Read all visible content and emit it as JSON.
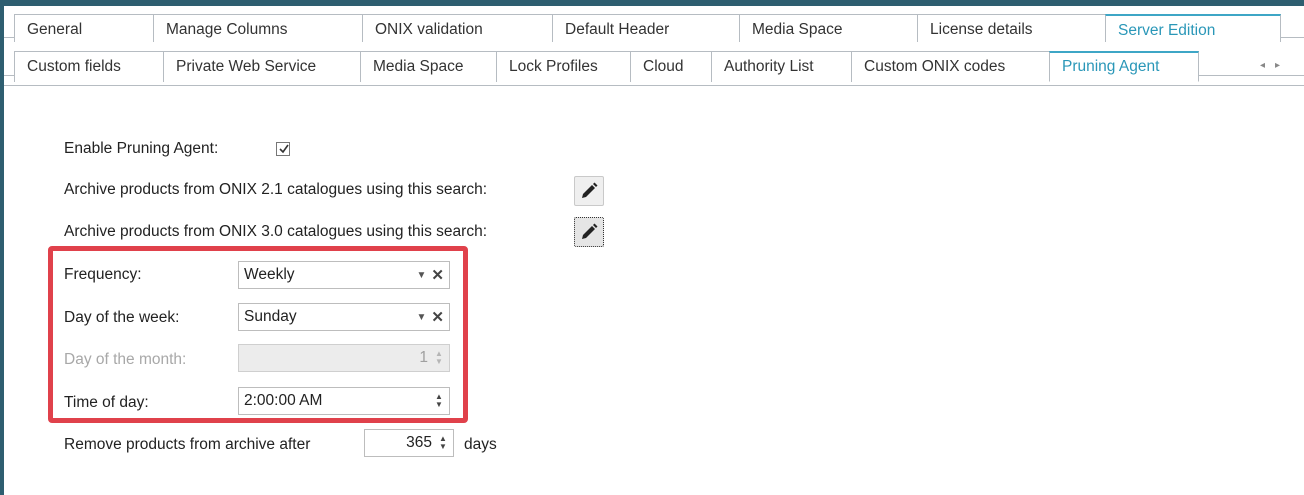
{
  "tabs_row1": [
    {
      "label": "General",
      "active": false
    },
    {
      "label": "Manage Columns",
      "active": false
    },
    {
      "label": "ONIX validation",
      "active": false
    },
    {
      "label": "Default Header",
      "active": false
    },
    {
      "label": "Media Space",
      "active": false
    },
    {
      "label": "License details",
      "active": false
    },
    {
      "label": "Server Edition",
      "active": true
    }
  ],
  "tabs_row2": [
    {
      "label": "Custom fields",
      "active": false
    },
    {
      "label": "Private Web Service",
      "active": false
    },
    {
      "label": "Media Space",
      "active": false
    },
    {
      "label": "Lock Profiles",
      "active": false
    },
    {
      "label": "Cloud",
      "active": false
    },
    {
      "label": "Authority List",
      "active": false
    },
    {
      "label": "Custom ONIX codes",
      "active": false
    },
    {
      "label": "Pruning Agent",
      "active": true
    }
  ],
  "tab_scroll": {
    "left": "◂",
    "right": "▸"
  },
  "form": {
    "enable_label": "Enable Pruning Agent:",
    "enable_checked": true,
    "archive21_label": "Archive products from ONIX 2.1 catalogues using this search:",
    "archive30_label": "Archive products from ONIX 3.0 catalogues using this search:",
    "frequency_label": "Frequency:",
    "frequency_value": "Weekly",
    "dow_label": "Day of the week:",
    "dow_value": "Sunday",
    "dom_label": "Day of the month:",
    "dom_value": "1",
    "tod_label": "Time of day:",
    "tod_value": "2:00:00 AM",
    "remove_label": "Remove products from archive after",
    "remove_value": "365",
    "remove_unit": "days"
  },
  "colors": {
    "accent": "#2a97b8",
    "highlight": "#e0414b",
    "frame": "#2e5e70"
  }
}
